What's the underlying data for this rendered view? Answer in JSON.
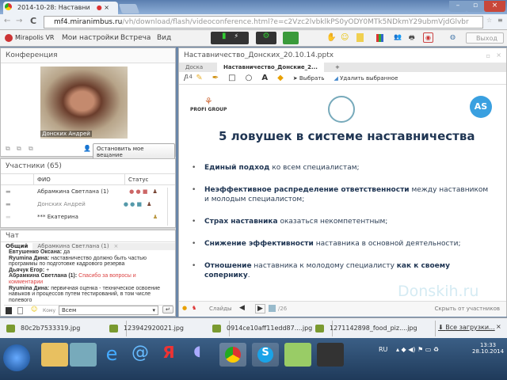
{
  "browser": {
    "tab_title": "2014-10-28: Наставни",
    "url_host": "mf4.miranimbus.ru",
    "url_path": "/vh/download/flash/videoconference.html?e=c2Vzc2lvbklkPS0yODY0MTk5NDkmY29ubmVjdGlvbr"
  },
  "app": {
    "logo": "Mirapolis VR",
    "menu": [
      "Мои настройки",
      "Встреча",
      "Вид"
    ],
    "logout": "Выход"
  },
  "conference": {
    "title": "Конференция",
    "video_name": "Донских Андрей",
    "stop_button": "Остановить мое вещание"
  },
  "participants": {
    "title": "Участники (65)",
    "col_name": "ФИО",
    "col_status": "Статус",
    "rows": [
      {
        "name": "Абрамкина Светлана (1)"
      },
      {
        "name": "Донских Андрей"
      },
      {
        "name": "*** Екатерина"
      }
    ]
  },
  "chat": {
    "title": "Чат",
    "tabs": [
      "Общий",
      "Абрамкина Светлана (1)"
    ],
    "messages": [
      {
        "author": "Евтушенко Оксана:",
        "text": "да"
      },
      {
        "author": "Ryumina Дина:",
        "text": "наставничество должно быть частью программы по подготовке кадрового резерва"
      },
      {
        "author": "Дьячук Егор:",
        "text": "+"
      },
      {
        "author": "Абрамкина Светлана (1):",
        "text": "Спасибо за вопросы и комментарии",
        "highlight": true
      },
      {
        "author": "Ryumina Дина:",
        "text": "первичная оценка  - техническое освоение навыков и процессов путем тестирований, в том числе полевого"
      }
    ],
    "to_label": "Кому",
    "to_value": "Всем"
  },
  "presentation": {
    "title": "Наставничество_Донских_20.10.14.pptx",
    "tabs": [
      "Доска 14",
      "Наставничество_Донские_2...",
      "+"
    ],
    "select_label": "Выбрать",
    "delete_label": "Удалить выбранное",
    "slide": {
      "logo_left": "PROFI GROUP",
      "logo_right": "AS",
      "heading": "5 ловушек в системе наставничества",
      "bullets": [
        {
          "bold": "Единый подход",
          "rest": " ко всем специалистам;"
        },
        {
          "bold": "Неэффективное распределение ответственности",
          "rest": " между наставником и молодым специалистом;"
        },
        {
          "bold": "Страх наставника",
          "rest": " оказаться некомпетентным;"
        },
        {
          "bold": "Снижение эффективности",
          "rest": " наставника в основной деятельности;"
        },
        {
          "bold": "Отношение",
          "rest": " наставника к молодому специалисту ",
          "bold2": "как к своему сопернику",
          "end": "."
        }
      ],
      "watermark": "Donskih.ru"
    },
    "slides_label": "Слайды",
    "page_total": "/26",
    "hide_label": "Скрыть от участников"
  },
  "downloads": {
    "items": [
      "80c2b7533319.jpg",
      "123942920021.jpg",
      "0914ce10aff11edd87....jpg",
      "1271142898_food_piz....jpg"
    ],
    "all": "Все загрузки..."
  },
  "taskbar": {
    "lang": "RU",
    "time": "13:33",
    "date": "28.10.2014"
  }
}
